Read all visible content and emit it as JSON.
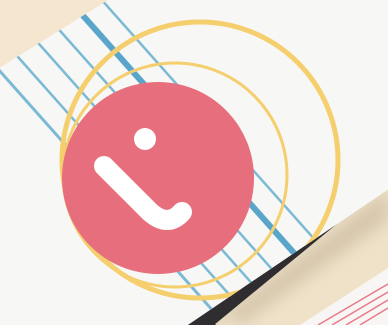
{
  "scene": {
    "description_free": true,
    "colors": {
      "background": "#f4e6cf",
      "card_face": "#f7f7f5",
      "card_edge": "#2c2a2c",
      "shadow": "#c9b79c",
      "circle_fill": "#e76f7d",
      "ring": "#f5cf6e",
      "stripe": "#7bbad4",
      "stripe_strong": "#5aa6cb",
      "logo_mark": "#ffffff",
      "second_card_line": "#e87b8a"
    },
    "icons": [
      "logo-mark-icon"
    ]
  }
}
